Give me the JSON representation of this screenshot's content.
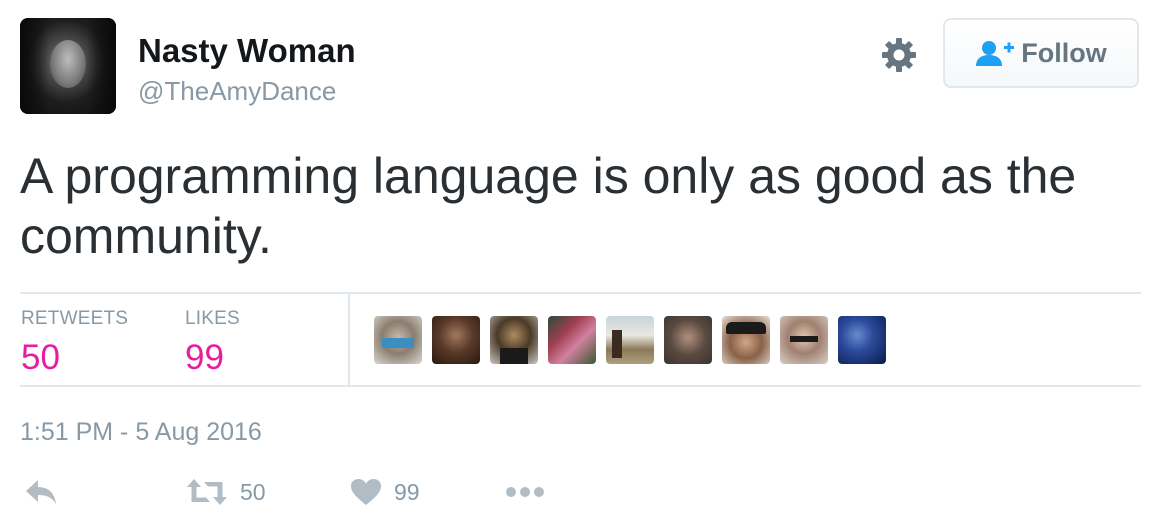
{
  "user": {
    "display_name": "Nasty Woman",
    "handle": "@TheAmyDance"
  },
  "header": {
    "settings_icon": "gear-icon",
    "follow_label": "Follow",
    "follow_icon": "add-user-icon"
  },
  "tweet": {
    "text": "A programming language is only as good as the community."
  },
  "stats": {
    "retweets_label": "RETWEETS",
    "retweets_value": "50",
    "likes_label": "LIKES",
    "likes_value": "99"
  },
  "likers_count": 9,
  "timestamp": "1:51 PM - 5 Aug 2016",
  "actions": {
    "reply_icon": "reply-icon",
    "retweet_icon": "retweet-icon",
    "retweet_count": "50",
    "like_icon": "heart-icon",
    "like_count": "99",
    "more_icon": "more-icon"
  },
  "colors": {
    "accent_pink": "#e81c9f",
    "muted": "#8899a6",
    "follow_blue": "#1da1f2",
    "text": "#292f33"
  }
}
